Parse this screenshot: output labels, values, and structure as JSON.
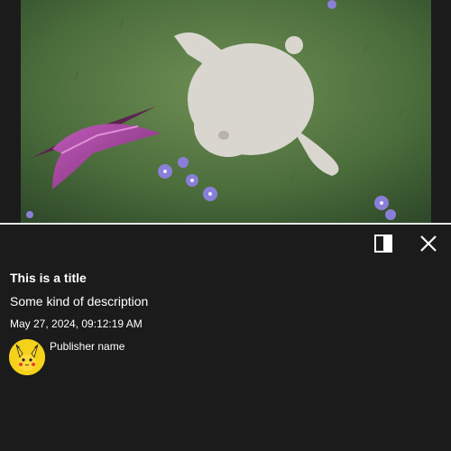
{
  "video": {
    "thumbnail_description": "animated rabbit lying on grass with a pink butterfly and purple flowers"
  },
  "toolbar": {
    "sidebar_toggle_icon": "sidebar-panel-icon",
    "close_icon": "close-icon"
  },
  "details": {
    "title": "This is a title",
    "description": "Some kind of description",
    "timestamp": "May 27, 2024, 09:12:19 AM"
  },
  "publisher": {
    "name": "Publisher name",
    "avatar_icon": "pikachu-avatar"
  },
  "colors": {
    "background": "#1b1b1c",
    "text": "#ffffff",
    "divider": "#e6e6e6",
    "avatar_bg": "#f5d21a"
  }
}
